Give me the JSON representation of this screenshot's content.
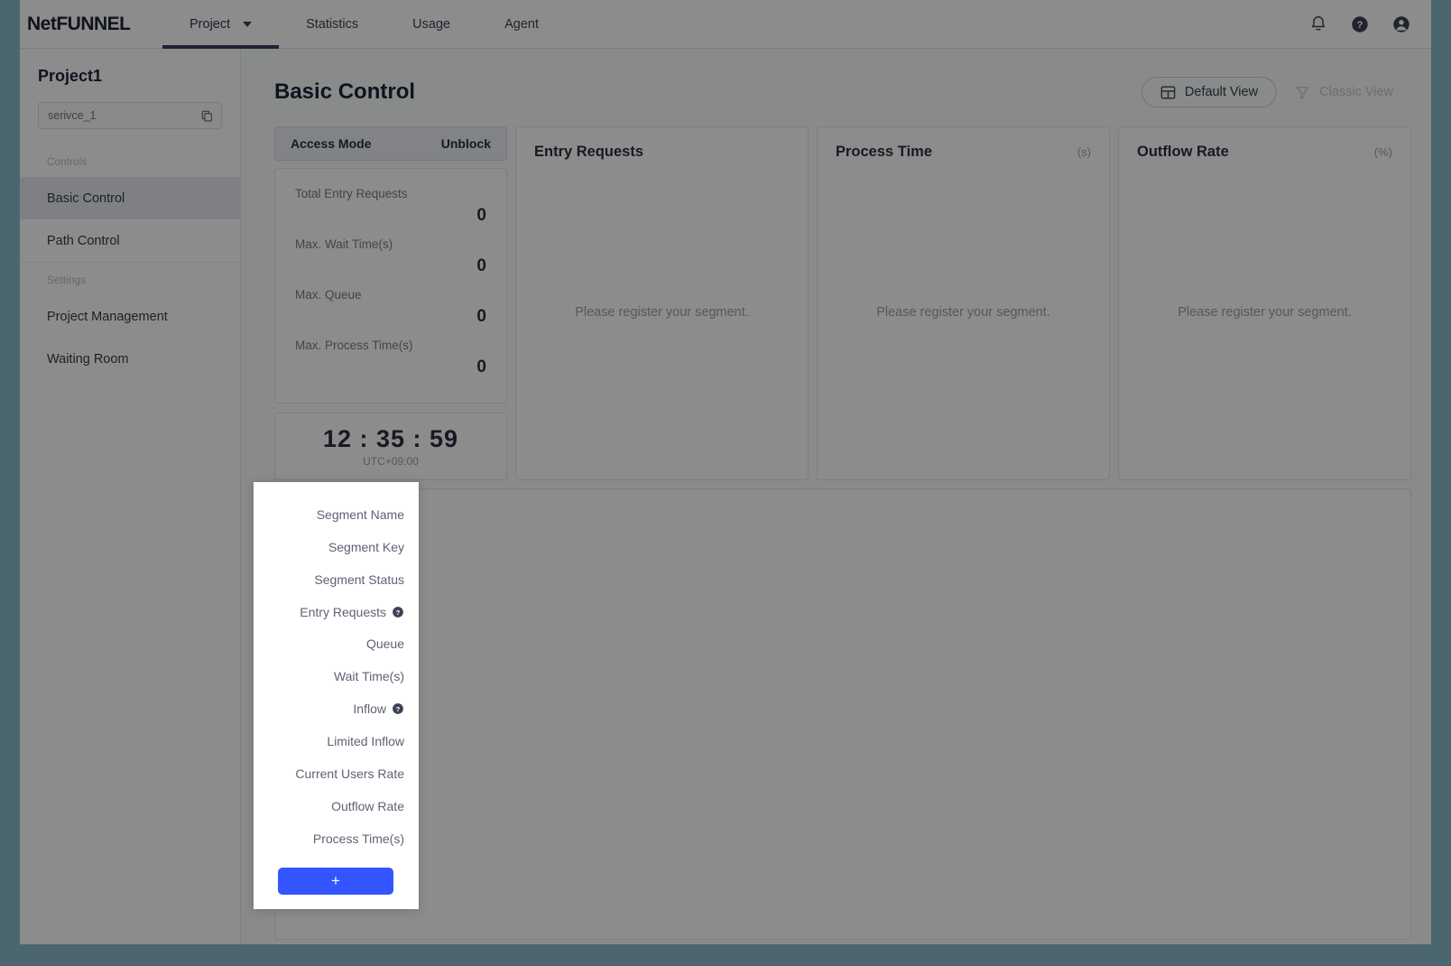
{
  "header": {
    "brand": "NetFUNNEL",
    "nav": [
      {
        "label": "Project",
        "active": true,
        "has_chevron": true
      },
      {
        "label": "Statistics",
        "active": false,
        "has_chevron": false
      },
      {
        "label": "Usage",
        "active": false,
        "has_chevron": false
      },
      {
        "label": "Agent",
        "active": false,
        "has_chevron": false
      }
    ],
    "icons": [
      "bell-icon",
      "help-icon",
      "account-icon"
    ]
  },
  "sidebar": {
    "project_title": "Project1",
    "service_input_value": "serivce_1",
    "service_input_placeholder": "serivce_1",
    "copy_icon": "copy-icon",
    "groups": [
      {
        "label": "Controls",
        "items": [
          {
            "label": "Basic Control",
            "selected": true
          },
          {
            "label": "Path Control",
            "selected": false
          }
        ]
      },
      {
        "label": "Settings",
        "items": [
          {
            "label": "Project Management",
            "selected": false
          },
          {
            "label": "Waiting Room",
            "selected": false
          }
        ]
      }
    ]
  },
  "main": {
    "page_title": "Basic Control",
    "view_toggle": [
      {
        "label": "Default View",
        "icon": "layout-icon",
        "active": true
      },
      {
        "label": "Classic View",
        "icon": "filter-icon",
        "active": false
      }
    ],
    "access_mode": {
      "label": "Access Mode",
      "value": "Unblock"
    },
    "stats": [
      {
        "label": "Total Entry Requests",
        "value": "0"
      },
      {
        "label": "Max. Wait Time(s)",
        "value": "0"
      },
      {
        "label": "Max. Queue",
        "value": "0"
      },
      {
        "label": "Max. Process Time(s)",
        "value": "0"
      }
    ],
    "clock": {
      "time": "12 : 35 : 59",
      "timezone": "UTC+09:00"
    },
    "charts": [
      {
        "title": "Entry Requests",
        "unit": "",
        "empty_text": "Please register your segment."
      },
      {
        "title": "Process Time",
        "unit": "(s)",
        "empty_text": "Please register your segment."
      },
      {
        "title": "Outflow Rate",
        "unit": "(%)",
        "empty_text": "Please register your segment."
      }
    ]
  },
  "popup": {
    "rows": [
      {
        "label": "Segment Name",
        "help": false
      },
      {
        "label": "Segment Key",
        "help": false
      },
      {
        "label": "Segment Status",
        "help": false
      },
      {
        "label": "Entry Requests",
        "help": true
      },
      {
        "label": "Queue",
        "help": false
      },
      {
        "label": "Wait Time(s)",
        "help": false
      },
      {
        "label": "Inflow",
        "help": true
      },
      {
        "label": "Limited Inflow",
        "help": false
      },
      {
        "label": "Current Users Rate",
        "help": false
      },
      {
        "label": "Outflow Rate",
        "help": false
      },
      {
        "label": "Process Time(s)",
        "help": false
      }
    ],
    "add_label": "+",
    "add_color": "#3355ff"
  },
  "colors": {
    "brand_dark": "#1e2436",
    "accent_blue": "#3355ff",
    "nav_underline": "#353f68",
    "sidebar_selected": "#e7eaf1",
    "page_frame": "#4c6670"
  }
}
